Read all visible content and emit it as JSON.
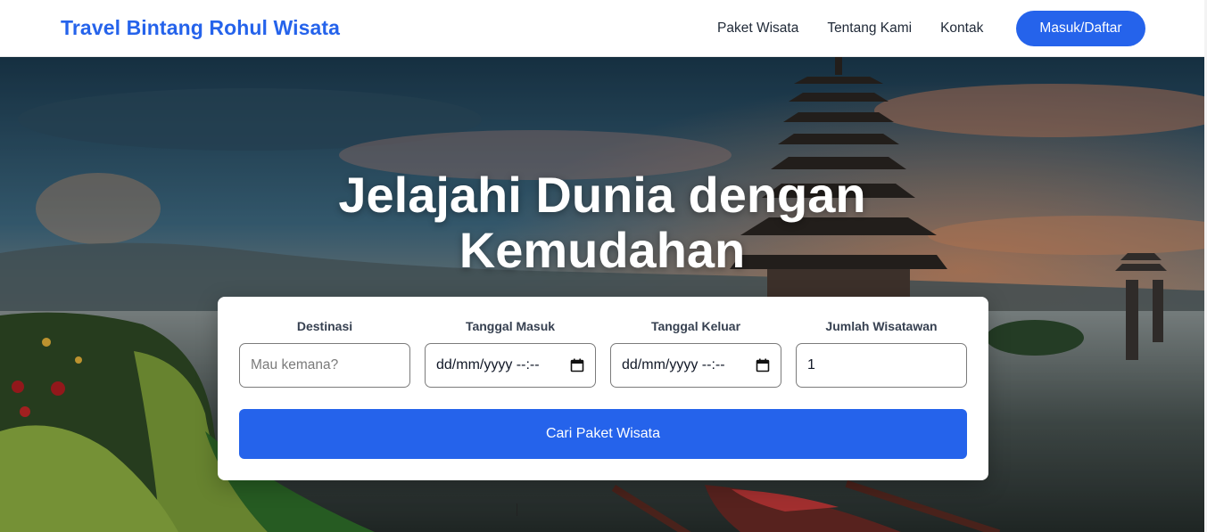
{
  "navbar": {
    "brand": "Travel Bintang Rohul Wisata",
    "links": [
      "Paket Wisata",
      "Tentang Kami",
      "Kontak"
    ],
    "cta_label": "Masuk/Daftar"
  },
  "hero": {
    "title_line1": "Jelajahi Dunia dengan",
    "title_line2": "Kemudahan",
    "background_icon": "bali-temple-lake-photo"
  },
  "search": {
    "destination": {
      "label": "Destinasi",
      "placeholder": "Mau kemana?"
    },
    "check_in": {
      "label": "Tanggal Masuk",
      "value": "dd/mm/yyyy --:--"
    },
    "check_out": {
      "label": "Tanggal Keluar",
      "value": "dd/mm/yyyy --:--"
    },
    "travelers": {
      "label": "Jumlah Wisatawan",
      "value": "1"
    },
    "submit_label": "Cari Paket Wisata"
  },
  "colors": {
    "accent": "#2563eb",
    "nav_text": "#1f2937",
    "label_text": "#374151"
  }
}
